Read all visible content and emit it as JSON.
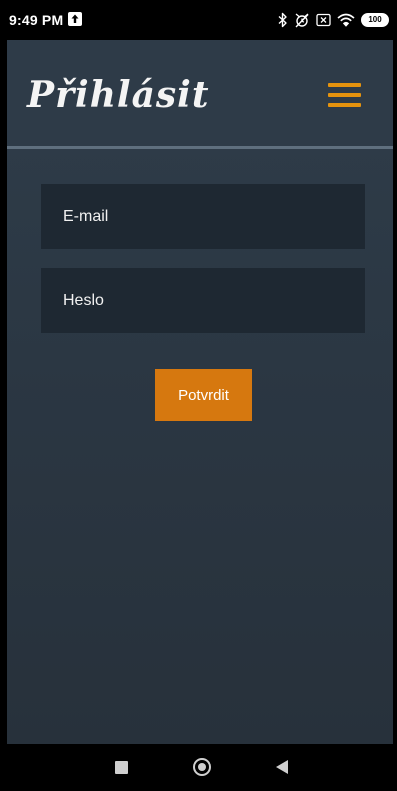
{
  "status_bar": {
    "time": "9:49 PM",
    "battery": "100",
    "icons": [
      "upload-icon",
      "bluetooth-icon",
      "alarm-off-icon",
      "sim-icon",
      "wifi-icon",
      "battery-icon"
    ]
  },
  "header": {
    "title": "Přihlásit",
    "menu_icon": "hamburger-menu-icon"
  },
  "form": {
    "email_placeholder": "E-mail",
    "password_placeholder": "Heslo",
    "submit_label": "Potvrdit"
  },
  "nav_bar": {
    "icons": [
      "recents-icon",
      "home-icon",
      "back-icon"
    ]
  },
  "colors": {
    "accent": "#e5930e",
    "button": "#d6780f",
    "field_bg": "#1e2832",
    "app_bg": "#2e3b48"
  }
}
